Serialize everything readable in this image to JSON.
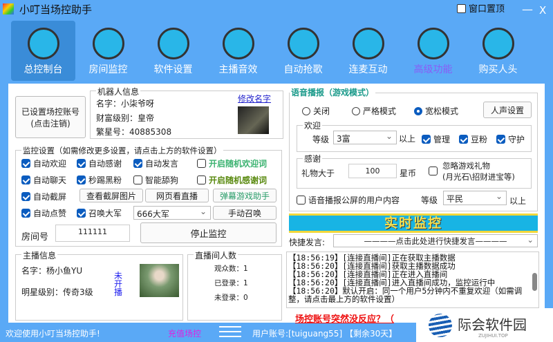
{
  "window": {
    "title": "小叮当场控助手",
    "pin_label": "窗口置顶",
    "minimize": "—",
    "close": "X"
  },
  "tabs": [
    {
      "label": "总控制台",
      "icon": "monitor-icon"
    },
    {
      "label": "房间监控",
      "icon": "webcam-icon"
    },
    {
      "label": "软件设置",
      "icon": "gear-icon"
    },
    {
      "label": "主播音效",
      "icon": "headphones-icon"
    },
    {
      "label": "自动抢歌",
      "icon": "music-disc-icon"
    },
    {
      "label": "连麦互动",
      "icon": "microphone-icon"
    },
    {
      "label": "高级功能",
      "icon": "crown-icon"
    },
    {
      "label": "购买人头",
      "icon": "gift-icon"
    }
  ],
  "account": {
    "line1": "已设置场控账号",
    "line2": "(点击注销)"
  },
  "robot": {
    "legend": "机器人信息",
    "name": "名字：小柒爷呀",
    "wealth": "财富级别：皇帝",
    "id": "繁星号：40885308",
    "rename": "修改名字"
  },
  "monitor": {
    "legend": "监控设置（如需修改更多设置，请点击上方的软件设置）",
    "checks": [
      {
        "label": "自动欢迎",
        "on": true
      },
      {
        "label": "自动感谢",
        "on": true
      },
      {
        "label": "自动发言",
        "on": true
      },
      {
        "label": "开启随机欢迎词",
        "on": false
      },
      {
        "label": "自动聊天",
        "on": true
      },
      {
        "label": "秒踢黑粉",
        "on": true
      },
      {
        "label": "智能舔狗",
        "on": false
      },
      {
        "label": "开启随机感谢词",
        "on": false
      },
      {
        "label": "自动截屏",
        "on": true
      },
      {
        "label": "自动点赞",
        "on": true
      },
      {
        "label": "召唤大军",
        "on": true
      }
    ],
    "view_screens": "查看截屏图片",
    "web_live": "网页看直播",
    "danmaku": "弹幕游戏助手",
    "army_select": "666大军",
    "manual_summon": "手动召唤",
    "room_label": "房间号",
    "room_value": "111111",
    "stop": "停止监控"
  },
  "anchor": {
    "legend": "主播信息",
    "name": "名字：杨小鱼YU",
    "level": "明星级别：传奇3级",
    "status": "未开播"
  },
  "count": {
    "legend": "直播间人数",
    "viewers": "观众数：1",
    "logged": "已登录：1",
    "unlogged": "未登录：0"
  },
  "voice": {
    "legend": "语音播报（游戏模式）",
    "modes": [
      {
        "label": "关闭",
        "on": false
      },
      {
        "label": "严格模式",
        "on": false
      },
      {
        "label": "宽松模式",
        "on": true
      }
    ],
    "voice_settings": "人声设置",
    "welcome": {
      "legend": "欢迎",
      "level_label": "等级",
      "level": "3富",
      "above": "以上",
      "checks": [
        {
          "label": "管理",
          "on": true
        },
        {
          "label": "豆粉",
          "on": true
        },
        {
          "label": "守护",
          "on": true
        }
      ]
    },
    "thanks": {
      "legend": "感谢",
      "gift_label": "礼物大于",
      "gift_value": "100",
      "unit": "星币",
      "ignore_line1": "忽略游戏礼物",
      "ignore_line2": "(月光石\\招财进宝等)",
      "ignore_on": false
    },
    "public": {
      "label": "语音播报公屏的用户内容",
      "on": false,
      "level_label": "等级",
      "level": "平民",
      "above": "以上"
    }
  },
  "banner": "实时监控",
  "quick": {
    "label": "快捷发言:",
    "placeholder": "————点击此处进行快捷发言————"
  },
  "log": [
    "【18:56:19】[连接直播间]正在获取主播数据",
    "【18:56:20】[连接直播间]获取主播数据成功",
    "【18:56:20】[连接直播间]正在进入直播间",
    "【18:56:20】[连接直播间]进入直播间成功，监控运行中",
    "【18:56:20】默认开启：同一个用户5分钟内不重复欢迎（如需调整，请点击最上方的软件设置）"
  ],
  "alert_link": "场控账号突然没反应？（",
  "status": {
    "welcome": "欢迎使用小叮当场控助手!",
    "recharge": "充值场控",
    "account": "用户账号:[tuiguang55]",
    "remaining": "【剩余30天】"
  },
  "watermark": {
    "name": "际会软件园",
    "sub": "ZUJIHUI.TOP"
  },
  "colors": {
    "bg": "#5aa9f6",
    "selected_tab": "#3a8cd8",
    "accent": "#0b5cbf",
    "green": "#3cb371",
    "purple": "#8a5cf6",
    "magenta": "#e020e0"
  }
}
